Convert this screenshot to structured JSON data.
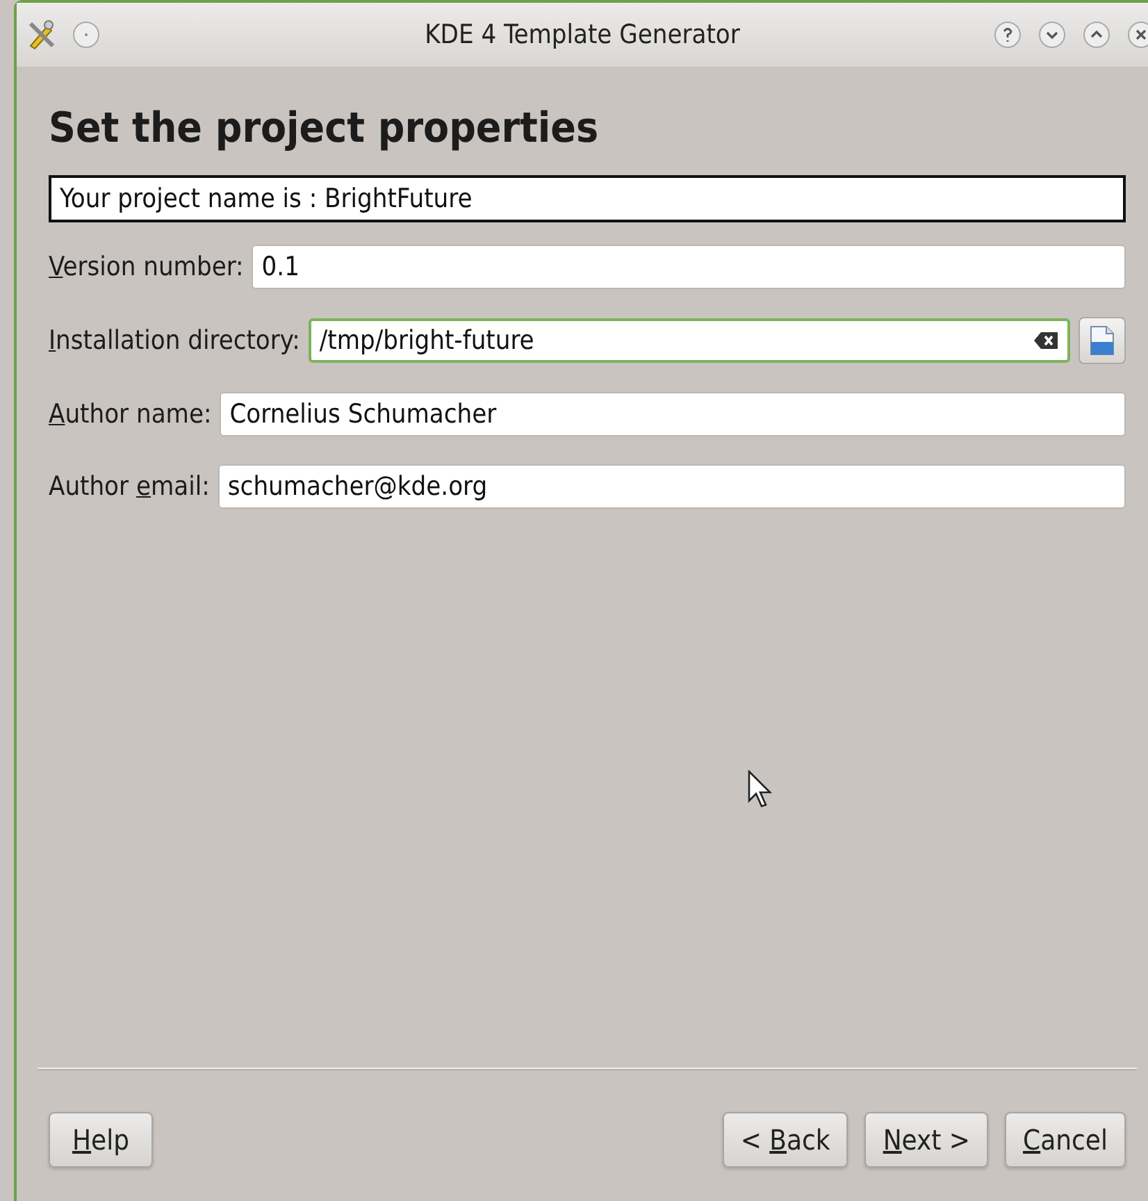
{
  "window": {
    "title": "KDE 4 Template Generator"
  },
  "heading": "Set the project properties",
  "project_name": "Your project name is : BrightFuture",
  "fields": [
    {
      "label": [
        {
          "text": "V",
          "underlined": true
        },
        {
          "text": "ersion number:",
          "underlined": false
        }
      ],
      "value": "0.1",
      "focused": false,
      "kind": "text"
    },
    {
      "label": [
        {
          "text": "I",
          "underlined": true
        },
        {
          "text": "nstallation directory:",
          "underlined": false
        }
      ],
      "value": "/tmp/bright-future",
      "focused": true,
      "kind": "path"
    },
    {
      "label": [
        {
          "text": "A",
          "underlined": true
        },
        {
          "text": "uthor name:",
          "underlined": false
        }
      ],
      "value": "Cornelius Schumacher",
      "focused": false,
      "kind": "text"
    },
    {
      "label": [
        {
          "text": "Author ",
          "underlined": false
        },
        {
          "text": "e",
          "underlined": true
        },
        {
          "text": "mail:",
          "underlined": false
        }
      ],
      "value": "schumacher@kde.org",
      "focused": false,
      "kind": "text"
    }
  ],
  "buttons": [
    {
      "label": [
        {
          "text": "H",
          "underlined": true
        },
        {
          "text": "elp",
          "underlined": false
        }
      ],
      "kind": "help"
    },
    {
      "label": [
        {
          "text": "< ",
          "underlined": false
        },
        {
          "text": "B",
          "underlined": true
        },
        {
          "text": "ack",
          "underlined": false
        }
      ],
      "kind": "nav"
    },
    {
      "label": [
        {
          "text": "N",
          "underlined": true
        },
        {
          "text": "ext >",
          "underlined": false
        }
      ],
      "kind": "nav"
    },
    {
      "label": [
        {
          "text": "C",
          "underlined": true
        },
        {
          "text": "ancel",
          "underlined": false
        }
      ],
      "kind": "nav"
    }
  ]
}
